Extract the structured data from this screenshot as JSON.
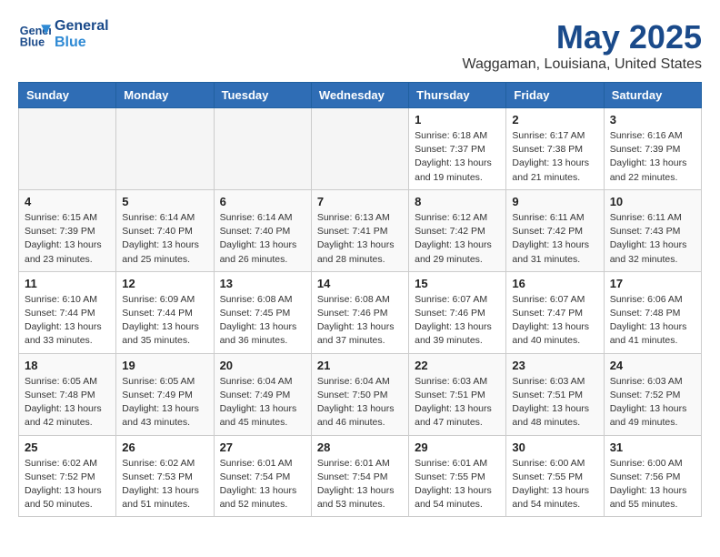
{
  "header": {
    "logo_line1": "General",
    "logo_line2": "Blue",
    "month_title": "May 2025",
    "location": "Waggaman, Louisiana, United States"
  },
  "weekdays": [
    "Sunday",
    "Monday",
    "Tuesday",
    "Wednesday",
    "Thursday",
    "Friday",
    "Saturday"
  ],
  "weeks": [
    [
      {
        "day": "",
        "info": ""
      },
      {
        "day": "",
        "info": ""
      },
      {
        "day": "",
        "info": ""
      },
      {
        "day": "",
        "info": ""
      },
      {
        "day": "1",
        "info": "Sunrise: 6:18 AM\nSunset: 7:37 PM\nDaylight: 13 hours\nand 19 minutes."
      },
      {
        "day": "2",
        "info": "Sunrise: 6:17 AM\nSunset: 7:38 PM\nDaylight: 13 hours\nand 21 minutes."
      },
      {
        "day": "3",
        "info": "Sunrise: 6:16 AM\nSunset: 7:39 PM\nDaylight: 13 hours\nand 22 minutes."
      }
    ],
    [
      {
        "day": "4",
        "info": "Sunrise: 6:15 AM\nSunset: 7:39 PM\nDaylight: 13 hours\nand 23 minutes."
      },
      {
        "day": "5",
        "info": "Sunrise: 6:14 AM\nSunset: 7:40 PM\nDaylight: 13 hours\nand 25 minutes."
      },
      {
        "day": "6",
        "info": "Sunrise: 6:14 AM\nSunset: 7:40 PM\nDaylight: 13 hours\nand 26 minutes."
      },
      {
        "day": "7",
        "info": "Sunrise: 6:13 AM\nSunset: 7:41 PM\nDaylight: 13 hours\nand 28 minutes."
      },
      {
        "day": "8",
        "info": "Sunrise: 6:12 AM\nSunset: 7:42 PM\nDaylight: 13 hours\nand 29 minutes."
      },
      {
        "day": "9",
        "info": "Sunrise: 6:11 AM\nSunset: 7:42 PM\nDaylight: 13 hours\nand 31 minutes."
      },
      {
        "day": "10",
        "info": "Sunrise: 6:11 AM\nSunset: 7:43 PM\nDaylight: 13 hours\nand 32 minutes."
      }
    ],
    [
      {
        "day": "11",
        "info": "Sunrise: 6:10 AM\nSunset: 7:44 PM\nDaylight: 13 hours\nand 33 minutes."
      },
      {
        "day": "12",
        "info": "Sunrise: 6:09 AM\nSunset: 7:44 PM\nDaylight: 13 hours\nand 35 minutes."
      },
      {
        "day": "13",
        "info": "Sunrise: 6:08 AM\nSunset: 7:45 PM\nDaylight: 13 hours\nand 36 minutes."
      },
      {
        "day": "14",
        "info": "Sunrise: 6:08 AM\nSunset: 7:46 PM\nDaylight: 13 hours\nand 37 minutes."
      },
      {
        "day": "15",
        "info": "Sunrise: 6:07 AM\nSunset: 7:46 PM\nDaylight: 13 hours\nand 39 minutes."
      },
      {
        "day": "16",
        "info": "Sunrise: 6:07 AM\nSunset: 7:47 PM\nDaylight: 13 hours\nand 40 minutes."
      },
      {
        "day": "17",
        "info": "Sunrise: 6:06 AM\nSunset: 7:48 PM\nDaylight: 13 hours\nand 41 minutes."
      }
    ],
    [
      {
        "day": "18",
        "info": "Sunrise: 6:05 AM\nSunset: 7:48 PM\nDaylight: 13 hours\nand 42 minutes."
      },
      {
        "day": "19",
        "info": "Sunrise: 6:05 AM\nSunset: 7:49 PM\nDaylight: 13 hours\nand 43 minutes."
      },
      {
        "day": "20",
        "info": "Sunrise: 6:04 AM\nSunset: 7:49 PM\nDaylight: 13 hours\nand 45 minutes."
      },
      {
        "day": "21",
        "info": "Sunrise: 6:04 AM\nSunset: 7:50 PM\nDaylight: 13 hours\nand 46 minutes."
      },
      {
        "day": "22",
        "info": "Sunrise: 6:03 AM\nSunset: 7:51 PM\nDaylight: 13 hours\nand 47 minutes."
      },
      {
        "day": "23",
        "info": "Sunrise: 6:03 AM\nSunset: 7:51 PM\nDaylight: 13 hours\nand 48 minutes."
      },
      {
        "day": "24",
        "info": "Sunrise: 6:03 AM\nSunset: 7:52 PM\nDaylight: 13 hours\nand 49 minutes."
      }
    ],
    [
      {
        "day": "25",
        "info": "Sunrise: 6:02 AM\nSunset: 7:52 PM\nDaylight: 13 hours\nand 50 minutes."
      },
      {
        "day": "26",
        "info": "Sunrise: 6:02 AM\nSunset: 7:53 PM\nDaylight: 13 hours\nand 51 minutes."
      },
      {
        "day": "27",
        "info": "Sunrise: 6:01 AM\nSunset: 7:54 PM\nDaylight: 13 hours\nand 52 minutes."
      },
      {
        "day": "28",
        "info": "Sunrise: 6:01 AM\nSunset: 7:54 PM\nDaylight: 13 hours\nand 53 minutes."
      },
      {
        "day": "29",
        "info": "Sunrise: 6:01 AM\nSunset: 7:55 PM\nDaylight: 13 hours\nand 54 minutes."
      },
      {
        "day": "30",
        "info": "Sunrise: 6:00 AM\nSunset: 7:55 PM\nDaylight: 13 hours\nand 54 minutes."
      },
      {
        "day": "31",
        "info": "Sunrise: 6:00 AM\nSunset: 7:56 PM\nDaylight: 13 hours\nand 55 minutes."
      }
    ]
  ]
}
